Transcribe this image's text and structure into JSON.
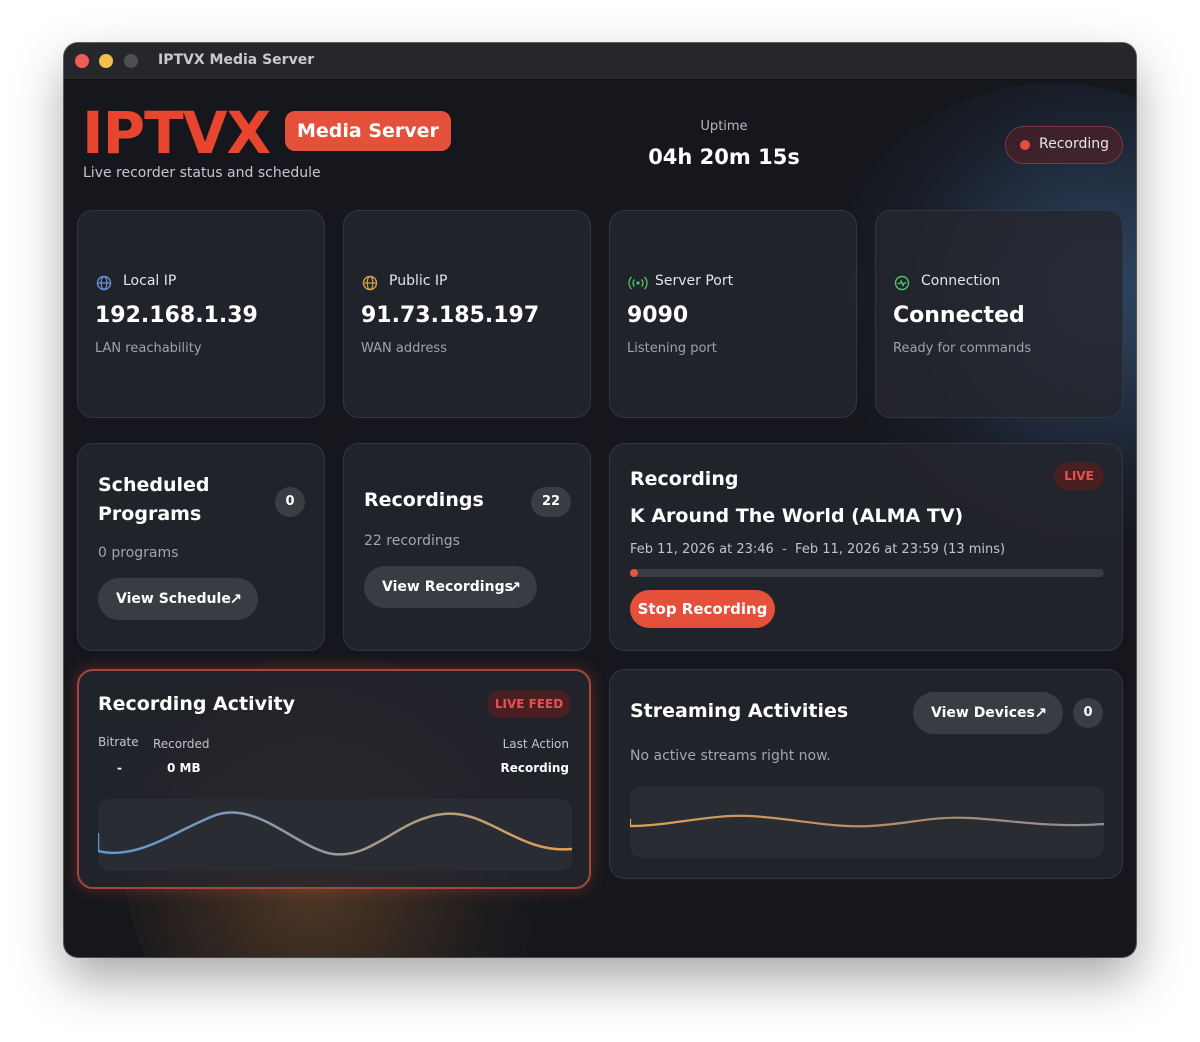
{
  "window": {
    "title": "IPTVX Media Server"
  },
  "header": {
    "logo_text": "IPTVX",
    "brand_pill": "Media Server",
    "subtitle": "Live recorder status and schedule",
    "uptime_label": "Uptime",
    "uptime_value": "04h 20m 15s",
    "status_pill": "Recording"
  },
  "stats": [
    {
      "label": "Local IP",
      "value": "192.168.1.39",
      "sub": "LAN reachability",
      "icon": "globe-icon",
      "color": "#6b8fd8"
    },
    {
      "label": "Public IP",
      "value": "91.73.185.197",
      "sub": "WAN address",
      "icon": "globe-icon",
      "color": "#d6a24a"
    },
    {
      "label": "Server Port",
      "value": "9090",
      "sub": "Listening port",
      "icon": "broadcast-icon",
      "color": "#4fc36b"
    },
    {
      "label": "Connection",
      "value": "Connected",
      "sub": "Ready for commands",
      "icon": "pulse-icon",
      "color": "#4fc36b"
    }
  ],
  "scheduled": {
    "title_line1": "Scheduled",
    "title_line2": "Programs",
    "count": "0",
    "sub": "0 programs",
    "button": "View Schedule"
  },
  "recordings": {
    "title": "Recordings",
    "count": "22",
    "sub": "22 recordings",
    "button": "View Recordings"
  },
  "now_recording": {
    "heading": "Recording",
    "badge": "LIVE",
    "program": "K Around The World (ALMA TV)",
    "time_range": "Feb 11, 2026 at 23:46  -  Feb 11, 2026 at 23:59 (13 mins)",
    "progress": 0.0,
    "stop_button": "Stop Recording"
  },
  "activity": {
    "title": "Recording Activity",
    "badge": "LIVE FEED",
    "bitrate_label": "Bitrate",
    "bitrate_value": "-",
    "recorded_label": "Recorded",
    "recorded_value": "0 MB",
    "last_action_label": "Last Action",
    "last_action_value": "Recording"
  },
  "streaming": {
    "title": "Streaming Activities",
    "button": "View Devices",
    "count": "0",
    "empty_text": "No active streams right now."
  },
  "colors": {
    "accent": "#e4503a",
    "live_red": "#e8524d",
    "wave_blue": "#6d9ad0",
    "wave_orange": "#e0a050"
  }
}
